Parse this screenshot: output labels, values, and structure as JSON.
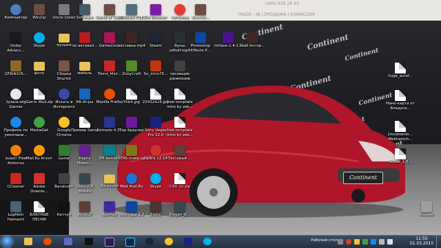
{
  "wallpaper": {
    "phone": "(499) 638 28 43",
    "nav": "TRADE - IN  |  ПРОДАЖА  |  КОМИССИЯ",
    "brand": "Continent"
  },
  "icons": [
    {
      "id": "computer",
      "label": "Компьютер",
      "kind": "round",
      "color": "#4a7fc0"
    },
    {
      "id": "dolby",
      "label": "Dolby Advanc...",
      "kind": "box",
      "color": "#1a1a1a"
    },
    {
      "id": "gtainsta",
      "label": "GTAINSTA...",
      "kind": "box",
      "color": "#8a6a2a"
    },
    {
      "id": "onepl",
      "label": "1place.org Games",
      "kind": "round",
      "color": "#e8e8e8"
    },
    {
      "id": "profile",
      "label": "Профиль по умолчани...",
      "kind": "round",
      "color": "#1e88e5"
    },
    {
      "id": "avast",
      "label": "avast! Free Antivirus",
      "kind": "round",
      "color": "#f57c00"
    },
    {
      "id": "ccleaner",
      "label": "CCleaner",
      "kind": "box",
      "color": "#c62828"
    },
    {
      "id": "logmein",
      "label": "LogMeIn Hamachi",
      "kind": "box",
      "color": "#4e5f70"
    },
    {
      "id": "winzip",
      "label": "WinZip",
      "kind": "box",
      "color": "#6d4c41"
    },
    {
      "id": "skype",
      "label": "Skype",
      "kind": "round",
      "color": "#00aff0"
    },
    {
      "id": "foto",
      "label": "фото",
      "kind": "folder",
      "color": "#e8c25a"
    },
    {
      "id": "garris",
      "label": "Garris Mod.zip",
      "kind": "doc",
      "color": "#ffffff"
    },
    {
      "id": "mediaget",
      "label": "MediaGet",
      "kind": "round",
      "color": "#43a047"
    },
    {
      "id": "mailru",
      "label": "Mail.Ru Агент",
      "kind": "round",
      "color": "#ff9800"
    },
    {
      "id": "adobe",
      "label": "Adobe Downlo...",
      "kind": "box",
      "color": "#d32f2f"
    },
    {
      "id": "blatnye",
      "label": "БЛАТНЫЕ ПЕСНИ",
      "kind": "doc",
      "color": "#ffffff"
    },
    {
      "id": "unclezoulias",
      "label": "Uncle Dolan",
      "kind": "box",
      "color": "#7b7b7b"
    },
    {
      "id": "muzyka",
      "label": "музыка",
      "kind": "folder",
      "color": "#e8c25a"
    },
    {
      "id": "sborka",
      "label": "Сборка Shurick",
      "kind": "box",
      "color": "#795548"
    },
    {
      "id": "iskat",
      "label": "Искать в Интернете",
      "kind": "round",
      "color": "#3949ab"
    },
    {
      "id": "chrome",
      "label": "Google Chrome",
      "kind": "round",
      "color": "#fbc02d"
    },
    {
      "id": "game",
      "label": "Game",
      "kind": "box",
      "color": "#2e7d32"
    },
    {
      "id": "bandicam",
      "label": "Bandicam",
      "kind": "box",
      "color": "#424242"
    },
    {
      "id": "ketchup",
      "label": "Кетчуп",
      "kind": "box",
      "color": "#111111"
    },
    {
      "id": "soft2",
      "label": "Software",
      "kind": "box",
      "color": "#455a64"
    },
    {
      "id": "avtoval",
      "label": "по автовал...",
      "kind": "box",
      "color": "#b71c1c"
    },
    {
      "id": "mebel",
      "label": "мебель",
      "kind": "folder",
      "color": "#e8c25a"
    },
    {
      "id": "kbgame",
      "label": "КБ-Игры",
      "kind": "box",
      "color": "#1565c0"
    },
    {
      "id": "primer",
      "label": "Пример Samp",
      "kind": "doc",
      "color": "#ffffff"
    },
    {
      "id": "karta",
      "label": "Карта Морск...",
      "kind": "box",
      "color": "#6a1b9a"
    },
    {
      "id": "ccgame",
      "label": "CRAZYCR Mobile",
      "kind": "box",
      "color": "#37474f"
    },
    {
      "id": "winamp",
      "label": "WinSCP",
      "kind": "box",
      "color": "#5d4037"
    },
    {
      "id": "worldtanks",
      "label": "World of Tanks",
      "kind": "box",
      "color": "#6d4c41"
    },
    {
      "id": "gamezona",
      "label": "GameZona",
      "kind": "box",
      "color": "#ad1457"
    },
    {
      "id": "trend",
      "label": "Trend_Micr...",
      "kind": "box",
      "color": "#c62828"
    },
    {
      "id": "mozila",
      "label": "Mozilla Firefox",
      "kind": "round",
      "color": "#e65100"
    },
    {
      "id": "kombi",
      "label": "Komodo 4.31",
      "kind": "box",
      "color": "#283593"
    },
    {
      "id": "sm",
      "label": "SM Remote",
      "kind": "box",
      "color": "#00838f"
    },
    {
      "id": "uqhe",
      "label": "Загрузки",
      "kind": "folder",
      "color": "#e8c25a"
    },
    {
      "id": "xenplay",
      "label": "XenPlay",
      "kind": "box",
      "color": "#4527a0"
    },
    {
      "id": "strelka",
      "label": "STRELKA FILES",
      "kind": "box",
      "color": "#546e7a"
    },
    {
      "id": "zaslonka",
      "label": "заставка.mp4",
      "kind": "box",
      "color": "#3e2723"
    },
    {
      "id": "zoby",
      "label": "ZobyCraft",
      "kind": "box",
      "color": "#558b2f"
    },
    {
      "id": "yhb",
      "label": "Yhb4.jpg",
      "kind": "doc",
      "color": "#ffffff"
    },
    {
      "id": "tlp",
      "label": "Тор Браузер",
      "kind": "box",
      "color": "#6a1b9a"
    },
    {
      "id": "gdemakup",
      "label": "GTA5 make up",
      "kind": "box",
      "color": "#827717"
    },
    {
      "id": "mowmail",
      "label": "Мой Mail.Ru",
      "kind": "round",
      "color": "#1976d2"
    },
    {
      "id": "mkstrp",
      "label": "текстура 2.7",
      "kind": "box",
      "color": "#0d47a1"
    },
    {
      "id": "ztrojan",
      "label": "Tor Browser",
      "kind": "box",
      "color": "#7b1fa2"
    },
    {
      "id": "steam",
      "label": "Steam",
      "kind": "round",
      "color": "#1b2838"
    },
    {
      "id": "sujintro",
      "label": "Su_intro75...",
      "kind": "box",
      "color": "#bf360c"
    },
    {
      "id": "22432",
      "label": "22432424.jpg",
      "kind": "doc",
      "color": "#ffffff"
    },
    {
      "id": "sony",
      "label": "Sony Vegas Pro 12.0",
      "kind": "box",
      "color": "#1a237e"
    },
    {
      "id": "oprafs",
      "label": "Opera 12.14",
      "kind": "round",
      "color": "#d32f2f"
    },
    {
      "id": "skyper",
      "label": "Skype",
      "kind": "round",
      "color": "#00aff0"
    },
    {
      "id": "eratic",
      "label": "Erotic",
      "kind": "box",
      "color": "#4e342e"
    },
    {
      "id": "pitomec",
      "label": "питомец",
      "kind": "round",
      "color": "#e53935"
    },
    {
      "id": "byns",
      "label": "Вунш sdfsdf.mp4",
      "kind": "box",
      "color": "#263238"
    },
    {
      "id": "chasovshik",
      "label": "часовщик джикосию",
      "kind": "box",
      "color": "#424242"
    },
    {
      "id": "freetemp1",
      "label": "free template intro by zek...",
      "kind": "doc",
      "color": "#ffffff"
    },
    {
      "id": "freetemp2",
      "label": "free template intro by zek...",
      "kind": "doc",
      "color": "#ffffff"
    },
    {
      "id": "tempbd",
      "label": "Тестовый ...",
      "kind": "box",
      "color": "#5d4037"
    },
    {
      "id": "c4d",
      "label": "C4D 10.zip",
      "kind": "doc",
      "color": "#ffffff"
    },
    {
      "id": "elegan",
      "label": "Elegan_B...",
      "kind": "box",
      "color": "#37474f"
    },
    {
      "id": "shurik",
      "label": "Shurick...",
      "kind": "box",
      "color": "#6d4c41"
    },
    {
      "id": "photoshop",
      "label": "Photoshop Effects P...",
      "kind": "box",
      "color": "#0d47a1"
    },
    {
      "id": "mrtasb",
      "label": "mrtase-1.4.1...",
      "kind": "box",
      "color": "#4a148c"
    },
    {
      "id": "skall",
      "label": "Skall Котор...",
      "kind": "box",
      "color": "#3e2723"
    },
    {
      "id": "huge",
      "label": "huge_avtof...",
      "kind": "doc",
      "color": "#ffffff"
    },
    {
      "id": "nano",
      "label": "Нано-карта от Владуса...",
      "kind": "doc",
      "color": "#ffffff"
    },
    {
      "id": "mcdown",
      "label": "[mcdownlo... Mekhanich...",
      "kind": "doc",
      "color": "#ffffff"
    },
    {
      "id": "nodus",
      "label": "Nodus_1.5...",
      "kind": "doc",
      "color": "#ffffff"
    },
    {
      "id": "korzina",
      "label": "Козлик",
      "kind": "box",
      "color": "#9e9e9e"
    }
  ],
  "taskbar": {
    "desktop_button": "Рабочий стол",
    "time": "11:55",
    "date": "01.03.2015"
  }
}
